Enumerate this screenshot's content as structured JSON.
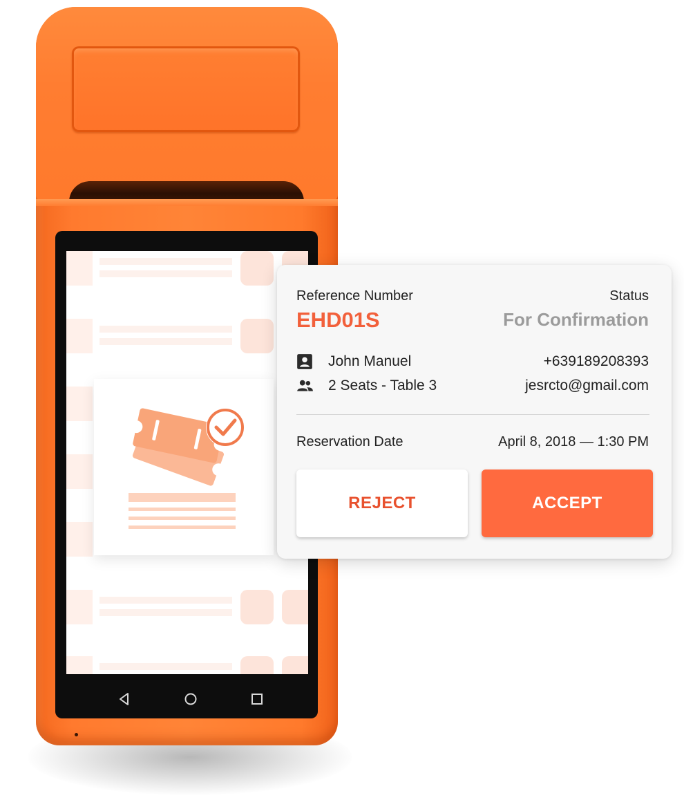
{
  "device": {
    "brand_color": "#ff7a2c",
    "nav_icons": [
      "back-triangle-icon",
      "home-circle-icon",
      "recents-square-icon"
    ]
  },
  "reservation": {
    "reference_label": "Reference Number",
    "reference_number": "EHD01S",
    "status_label": "Status",
    "status_value": "For Confirmation",
    "customer_name": "John Manuel",
    "seats": "2 Seats - Table 3",
    "phone": "+639189208393",
    "email": "jesrcto@gmail.com",
    "date_label": "Reservation Date",
    "date_value": "April 8, 2018 — 1:30 PM"
  },
  "actions": {
    "reject_label": "REJECT",
    "accept_label": "ACCEPT"
  },
  "colors": {
    "accent": "#f2603b",
    "accept_bg": "#ff6a3f",
    "muted": "#9b9b9b"
  }
}
